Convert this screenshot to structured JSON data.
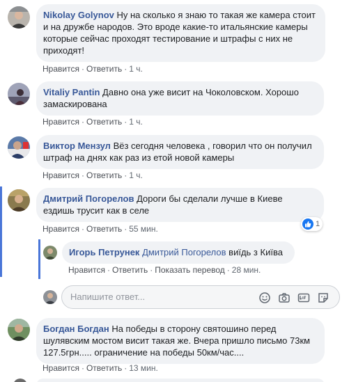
{
  "comments": [
    {
      "author": "Nikolay Golynov",
      "text": "Ну на сколько я знаю то такая же камера стоит и на дружбе народов. Это вроде какие-то итальянские камеры которые сейчас проходят тестирование и штрафы с них не приходят!",
      "like": "Нравится",
      "reply": "Ответить",
      "time": "1 ч."
    },
    {
      "author": "Vitaliy Pantin",
      "text": "Давно она уже висит на Чоколовском. Хорошо замаскирована",
      "like": "Нравится",
      "reply": "Ответить",
      "time": "1 ч."
    },
    {
      "author": "Виктор Мензул",
      "text": "Вёз сегодня человека , говорил что он получил штраф на днях как раз из етой новой камеры",
      "like": "Нравится",
      "reply": "Ответить",
      "time": "1 ч."
    },
    {
      "author": "Дмитрий Погорелов",
      "text": "Дороги бы сделали лучше в Киеве ездишь трусит как в селе",
      "like": "Нравится",
      "reply": "Ответить",
      "time": "55 мин.",
      "reaction_count": "1"
    },
    {
      "author": "Богдан Богдан",
      "text": "На победы в сторону святошино перед шулявским мостом висит такая же. Вчера пришло письмо 73км 127.5грн..... ограничение на победы 50км/час....",
      "like": "Нравится",
      "reply": "Ответить",
      "time": "13 мин."
    }
  ],
  "reply": {
    "author": "Игорь Петрунек",
    "mention": "Дмитрий Погорелов",
    "text": "виїдь з Київа",
    "like": "Нравится",
    "reply": "Ответить",
    "translate": "Показать перевод",
    "time": "28 мин."
  },
  "reply_box": {
    "placeholder": "Напишите ответ..."
  },
  "colors": {
    "author": "#385898",
    "thread_line": "#4a76d8",
    "bubble": "#f0f2f5",
    "like": "#1877f2"
  }
}
